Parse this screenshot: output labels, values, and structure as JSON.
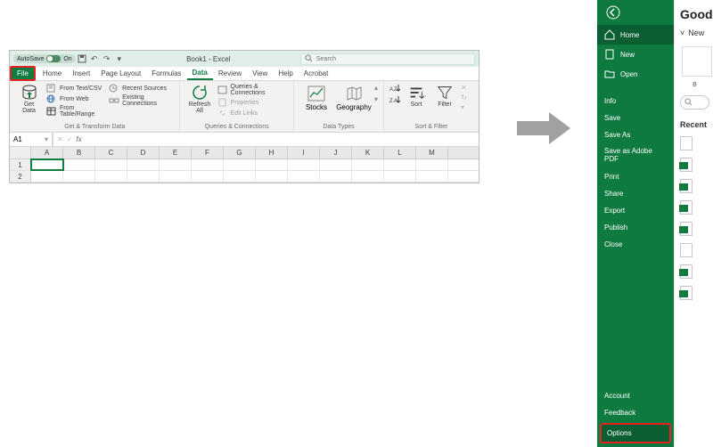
{
  "titlebar": {
    "autosave_label": "AutoSave",
    "autosave_state": "On",
    "doc_title": "Book1 - Excel",
    "search_placeholder": "Search"
  },
  "tabs": {
    "file": "File",
    "home": "Home",
    "insert": "Insert",
    "page_layout": "Page Layout",
    "formulas": "Formulas",
    "data": "Data",
    "review": "Review",
    "view": "View",
    "help": "Help",
    "acrobat": "Acrobat"
  },
  "ribbon": {
    "get_data": "Get\nData",
    "from_text": "From Text/CSV",
    "from_web": "From Web",
    "from_table": "From Table/Range",
    "recent_sources": "Recent Sources",
    "existing_conn": "Existing Connections",
    "grp_get": "Get & Transform Data",
    "refresh_all": "Refresh\nAll",
    "queries_conn": "Queries & Connections",
    "properties": "Properties",
    "edit_links": "Edit Links",
    "grp_queries": "Queries & Connections",
    "stocks": "Stocks",
    "geography": "Geography",
    "grp_datatypes": "Data Types",
    "sort_az": "A→Z",
    "sort": "Sort",
    "filter": "Filter",
    "grp_sortfilter": "Sort & Filter"
  },
  "formula_bar": {
    "namebox": "A1",
    "fx": "fx"
  },
  "grid": {
    "cols": [
      "A",
      "B",
      "C",
      "D",
      "E",
      "F",
      "G",
      "H",
      "I",
      "J",
      "K",
      "L",
      "M"
    ],
    "rows": [
      "1",
      "2"
    ]
  },
  "backstage": {
    "heading": "Good",
    "new_label": "New",
    "sidebar": {
      "home": "Home",
      "new": "New",
      "open": "Open",
      "info": "Info",
      "save": "Save",
      "save_as": "Save As",
      "save_adobe": "Save as Adobe PDF",
      "print": "Print",
      "share": "Share",
      "export": "Export",
      "publish": "Publish",
      "close": "Close",
      "account": "Account",
      "feedback": "Feedback",
      "options": "Options"
    },
    "thumb_caption": "B",
    "recent": "Recent"
  }
}
